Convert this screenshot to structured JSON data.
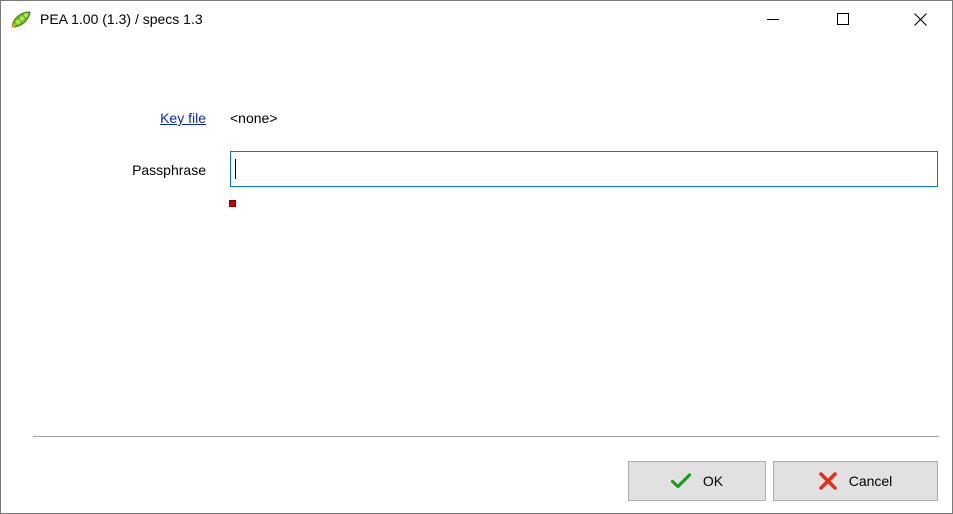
{
  "window": {
    "title": "PEA 1.00 (1.3) / specs 1.3",
    "app_icon": "pea-pod-icon",
    "controls": {
      "minimize_icon": "minimize-icon",
      "maximize_icon": "maximize-icon",
      "close_icon": "close-icon"
    }
  },
  "form": {
    "key_file_label": "Key file",
    "key_file_value": "<none>",
    "passphrase_label": "Passphrase",
    "passphrase_value": "",
    "strength_indicator_color": "#d10000"
  },
  "buttons": {
    "ok_label": "OK",
    "ok_icon": "checkmark-icon",
    "ok_icon_color": "#1a9e1a",
    "cancel_label": "Cancel",
    "cancel_icon": "x-icon",
    "cancel_icon_color": "#e0301e"
  }
}
